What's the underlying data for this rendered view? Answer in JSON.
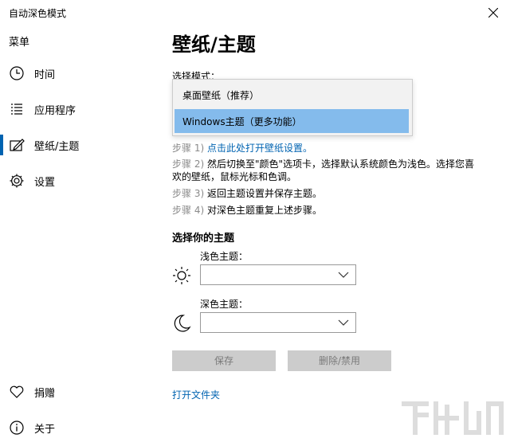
{
  "window": {
    "title": "自动深色模式"
  },
  "sidebar": {
    "menu_title": "菜单",
    "items": [
      {
        "label": "时间",
        "icon": "clock-icon"
      },
      {
        "label": "应用程序",
        "icon": "list-icon"
      },
      {
        "label": "壁纸/主题",
        "icon": "edit-icon",
        "selected": true
      },
      {
        "label": "设置",
        "icon": "gear-icon"
      }
    ],
    "bottom_items": [
      {
        "label": "捐赠",
        "icon": "heart-icon"
      },
      {
        "label": "关于",
        "icon": "info-icon"
      }
    ]
  },
  "main": {
    "title": "壁纸/主题",
    "mode_label": "选择模式：",
    "dropdown_options": [
      "桌面壁纸（推荐）",
      "Windows主题（更多功能）"
    ],
    "selected_option": "Windows主题（更多功能）",
    "steps": [
      {
        "num": "步骤 1)",
        "text": "点击此处打开壁纸设置。"
      },
      {
        "num": "步骤 2)",
        "text": "然后切换至\"颜色\"选项卡，选择默认系统颜色为浅色。选择您喜欢的壁纸，鼠标光标和色调。"
      },
      {
        "num": "步骤 3)",
        "text": "返回主题设置并保存主题。"
      },
      {
        "num": "步骤 4)",
        "text": "对深色主题重复上述步骤。"
      }
    ],
    "section_title": "选择你的主题",
    "light_label": "浅色主题：",
    "dark_label": "深色主题：",
    "save_label": "保存",
    "delete_label": "删除/禁用",
    "open_folder": "打开文件夹"
  },
  "colors": {
    "accent": "#0063b1",
    "selected_option": "#84bbec",
    "button_disabled": "#cccccc"
  }
}
